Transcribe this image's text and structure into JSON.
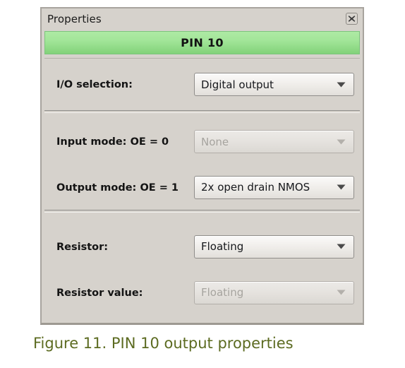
{
  "panel": {
    "title": "Properties",
    "close_icon": "close-icon",
    "header": {
      "label": "PIN 10",
      "background_color": "#a2e599"
    },
    "groups": [
      {
        "rows": [
          {
            "label": "I/O selection:",
            "sublabel": "",
            "control": {
              "type": "combobox",
              "value": "Digital output",
              "disabled": false
            }
          }
        ]
      },
      {
        "rows": [
          {
            "label": "Input mode:",
            "sublabel": "OE = 0",
            "control": {
              "type": "combobox",
              "value": "None",
              "disabled": true
            }
          },
          {
            "label": "Output mode:",
            "sublabel": "OE = 1",
            "control": {
              "type": "combobox",
              "value": "2x open drain NMOS",
              "disabled": false
            }
          }
        ]
      },
      {
        "rows": [
          {
            "label": "Resistor:",
            "sublabel": "",
            "control": {
              "type": "combobox",
              "value": "Floating",
              "disabled": false
            }
          },
          {
            "label": "Resistor value:",
            "sublabel": "",
            "control": {
              "type": "combobox",
              "value": "Floating",
              "disabled": true
            }
          }
        ]
      }
    ]
  },
  "caption": {
    "text": "Figure 11. PIN 10 output properties",
    "color": "#5c6b21"
  }
}
